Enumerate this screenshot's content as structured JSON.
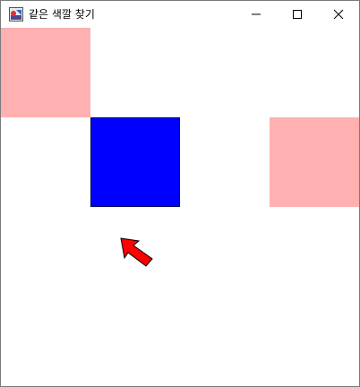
{
  "window": {
    "title": "같은 색깔 찾기",
    "buttons": {
      "minimize": "minimize-icon",
      "maximize": "maximize-icon",
      "close": "close-icon"
    }
  },
  "board": {
    "tiles": [
      {
        "id": "tile-1",
        "color": "#ffb0b0"
      },
      {
        "id": "tile-2",
        "color": "#0000ff"
      },
      {
        "id": "tile-3",
        "color": "#ffb0b0"
      }
    ]
  },
  "pointer": {
    "icon": "arrow-pointer-icon",
    "color": "#ff0000"
  }
}
